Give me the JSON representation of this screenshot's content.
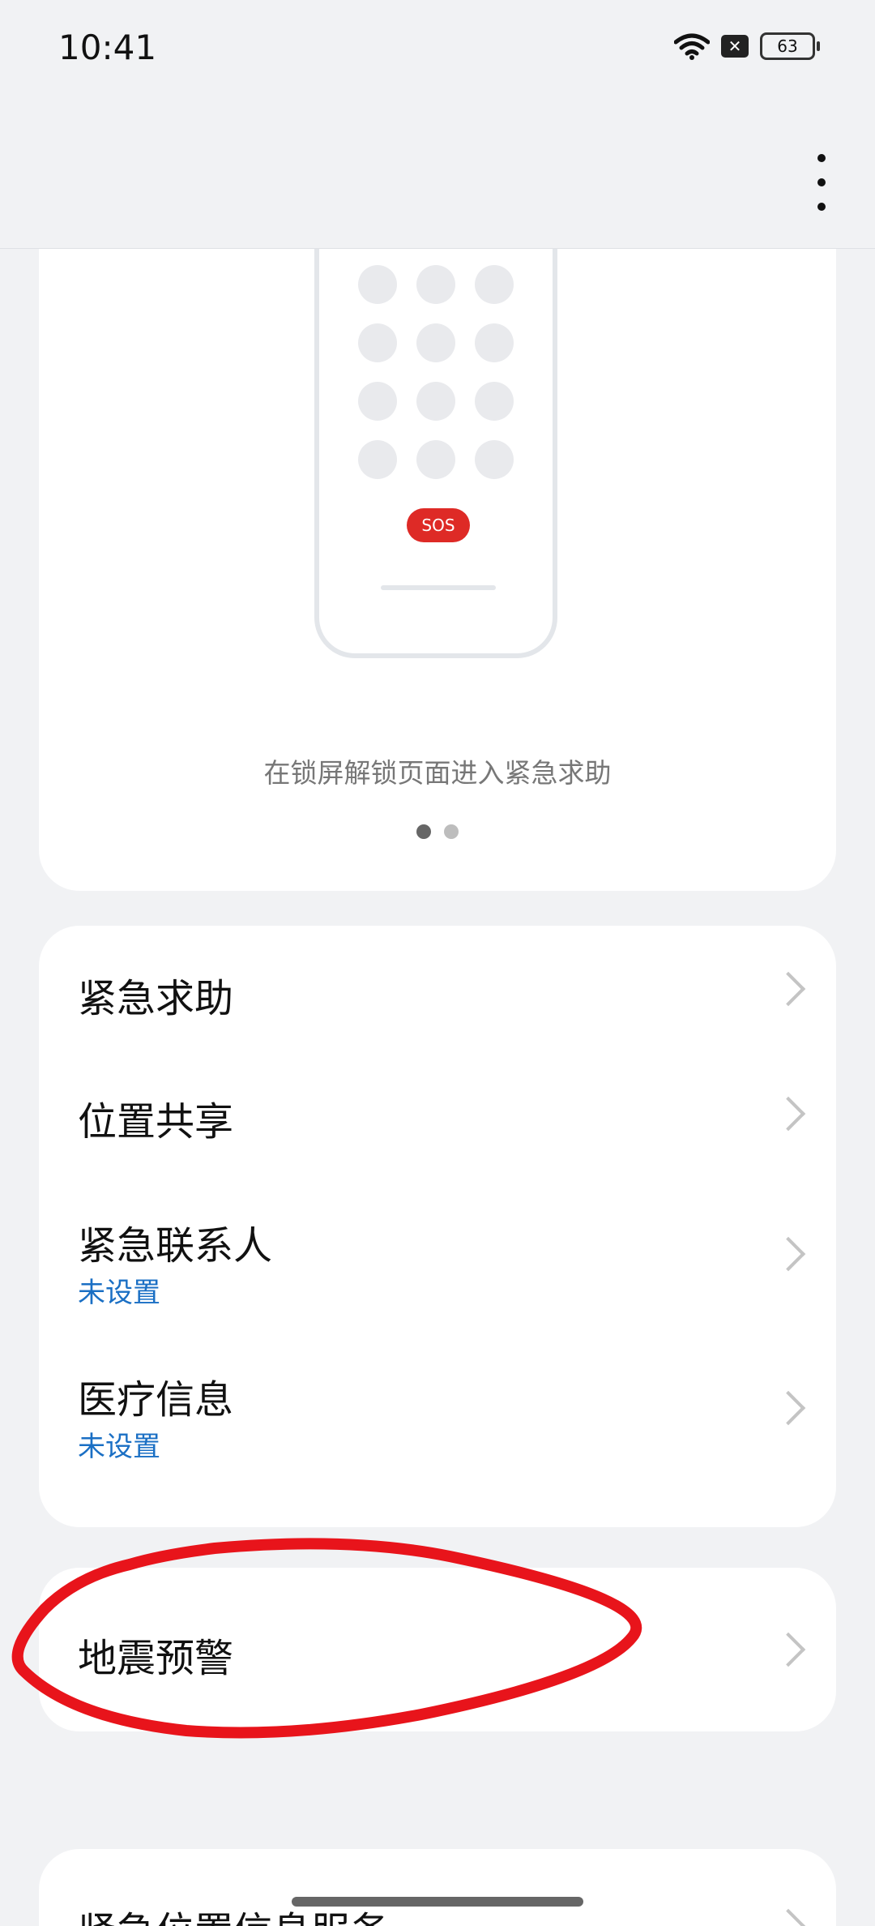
{
  "status_bar": {
    "time": "10:41",
    "battery": "63"
  },
  "illustration": {
    "sos_label": "SOS",
    "caption": "在锁屏解锁页面进入紧急求助",
    "page_count": 2,
    "active_page": 1
  },
  "menu": {
    "items": [
      {
        "label": "紧急求助"
      },
      {
        "label": "位置共享"
      },
      {
        "label": "紧急联系人",
        "sub": "未设置"
      },
      {
        "label": "医疗信息",
        "sub": "未设置"
      }
    ]
  },
  "earthquake": {
    "label": "地震预警"
  },
  "bottom_item": {
    "label": "紧急位置信息服务"
  },
  "colors": {
    "accent_blue": "#1a6fc4",
    "sos_red": "#de2a26",
    "annotation_red": "#e8141b"
  }
}
